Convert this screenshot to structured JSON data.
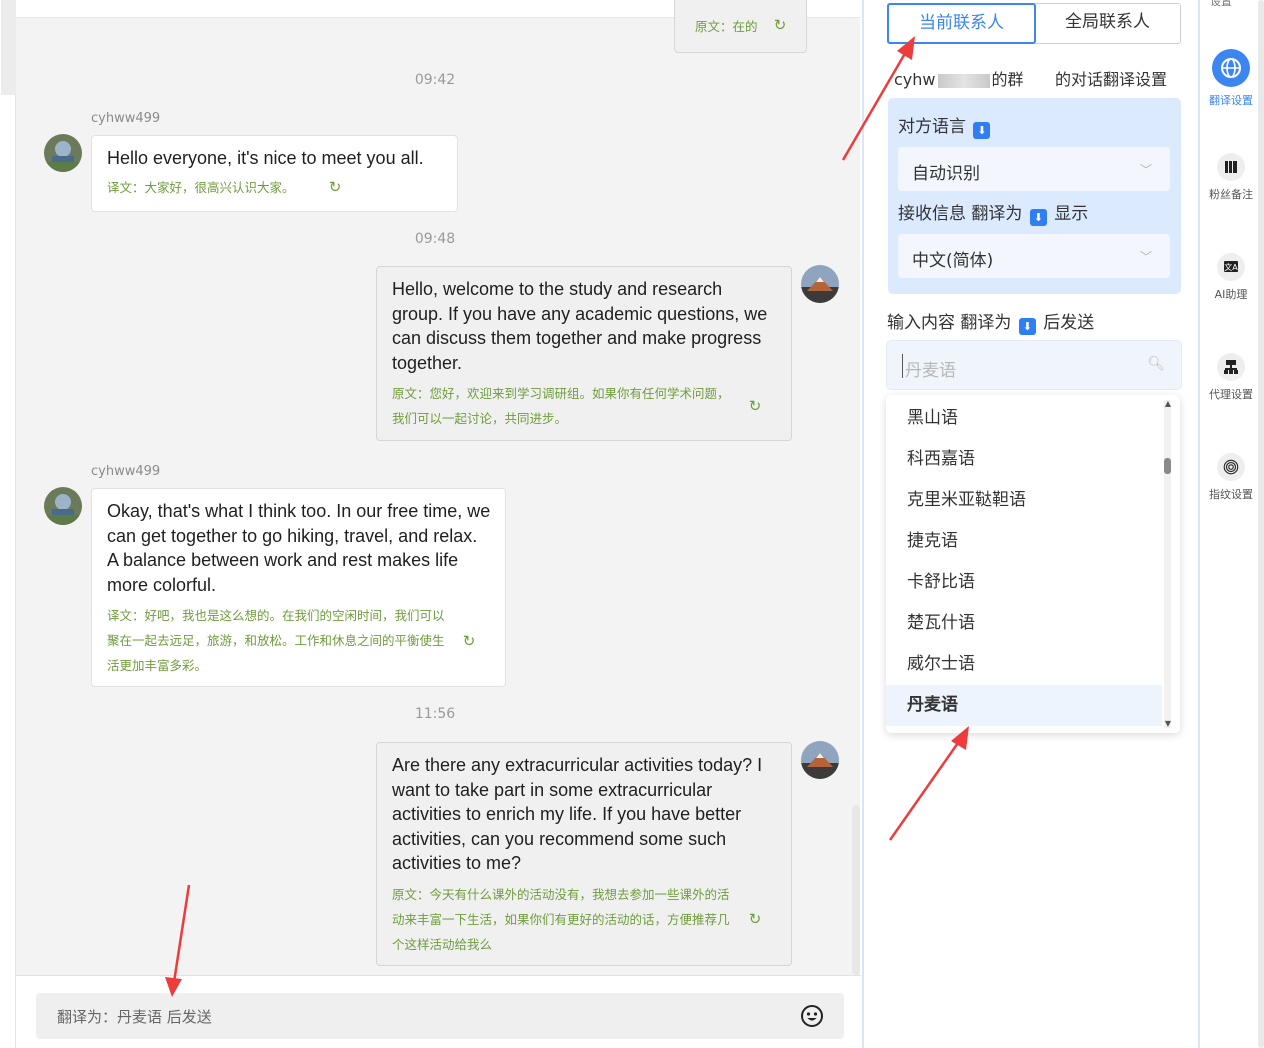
{
  "chat": {
    "top_bubble_text": "原文：在的",
    "messages": [
      {
        "time": "09:42",
        "sender": "cyhww499",
        "direction": "in",
        "text": "Hello everyone, it's nice to meet you all.",
        "translation": "译文：大家好，很高兴认识大家。"
      },
      {
        "time": "09:48",
        "direction": "out",
        "text": "Hello, welcome to the study and research group. If you have any academic questions, we can discuss them together and make progress together.",
        "translation": "原文：您好，欢迎来到学习调研组。如果你有任何学术问题，我们可以一起讨论，共同进步。"
      },
      {
        "sender": "cyhww499",
        "direction": "in",
        "text": "Okay, that's what I think too. In our free time, we can get together to go hiking, travel, and relax. A balance between work and rest makes life more colorful.",
        "translation": "译文：好吧，我也是这么想的。在我们的空闲时间，我们可以聚在一起去远足，旅游，和放松。工作和休息之间的平衡使生活更加丰富多彩。"
      },
      {
        "time": "11:56",
        "direction": "out",
        "text": "Are there any extracurricular activities today? I want to take part in some extracurricular activities to enrich my life. If you have better activities, can you recommend some such activities to me?",
        "translation": "原文：今天有什么课外的活动没有，我想去参加一些课外的活动来丰富一下生活，如果你们有更好的活动的话，方便推荐几个这样活动给我么"
      }
    ],
    "input_placeholder": "翻译为：丹麦语 后发送"
  },
  "panel": {
    "tabs": [
      {
        "label": "当前联系人",
        "active": true
      },
      {
        "label": "全局联系人",
        "active": false
      }
    ],
    "group_prefix": "cyhw",
    "group_suffix": "的群",
    "settings_title": "的对话翻译设置",
    "their_language_label": "对方语言",
    "their_language_value": "自动识别",
    "receive_label_1": "接收信息 翻译为",
    "receive_label_2": "显示",
    "receive_value": "中文(简体)",
    "input_label_1": "输入内容 翻译为",
    "input_label_2": "后发送",
    "search_placeholder": "丹麦语",
    "options": [
      "黑山语",
      "科西嘉语",
      "克里米亚鞑靼语",
      "捷克语",
      "卡舒比语",
      "楚瓦什语",
      "威尔士语",
      "丹麦语"
    ],
    "selected_option": "丹麦语"
  },
  "iconbar": {
    "top_cut_label": "设置",
    "items": [
      {
        "label": "翻译设置",
        "icon": "globe-icon",
        "active": true
      },
      {
        "label": "粉丝备注",
        "icon": "notes-icon",
        "active": false
      },
      {
        "label": "AI助理",
        "icon": "ai-translate-icon",
        "active": false
      },
      {
        "label": "代理设置",
        "icon": "proxy-network-icon",
        "active": false
      },
      {
        "label": "指纹设置",
        "icon": "fingerprint-icon",
        "active": false
      }
    ]
  },
  "colors": {
    "accent": "#3b86f0",
    "translation_text": "#6f9d3c",
    "annotation_arrow": "#ee3b3b"
  }
}
